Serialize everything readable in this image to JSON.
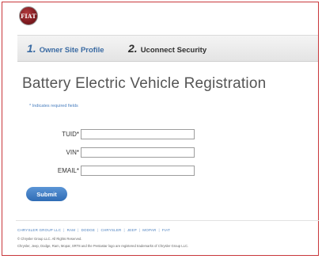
{
  "brand": {
    "logo_text": "FIAT"
  },
  "steps": [
    {
      "number": "1.",
      "label": "Owner Site Profile",
      "state": "active",
      "color": "#3b6ba3"
    },
    {
      "number": "2.",
      "label": "Uconnect Security",
      "state": "inactive",
      "color": "#2e2e2e"
    }
  ],
  "page": {
    "title": "Battery Electric Vehicle Registration",
    "required_note": "* Indicates required fields"
  },
  "form": {
    "fields": [
      {
        "label": "TUID*",
        "value": "",
        "placeholder": ""
      },
      {
        "label": "VIN*",
        "value": "",
        "placeholder": ""
      },
      {
        "label": "EMAIL*",
        "value": "",
        "placeholder": ""
      }
    ],
    "submit_label": "Submit"
  },
  "footer": {
    "links": [
      "CHRYSLER GROUP LLC",
      "RAM",
      "DODGE",
      "CHRYSLER",
      "JEEP",
      "MOPAR",
      "FIAT"
    ],
    "separator": "|",
    "copyright": "© Chrysler Group LLC. All Rights Reserved.",
    "trademark": "Chrysler, Jeep, Dodge, Ram, Mopar, SRT8 and the Pentastar logo are registered trademarks of Chrysler Group LLC."
  },
  "colors": {
    "accent": "#3b6ba3",
    "button": "#2f6cb5",
    "frame_border": "#c9373b",
    "link": "#4a7fbf"
  }
}
